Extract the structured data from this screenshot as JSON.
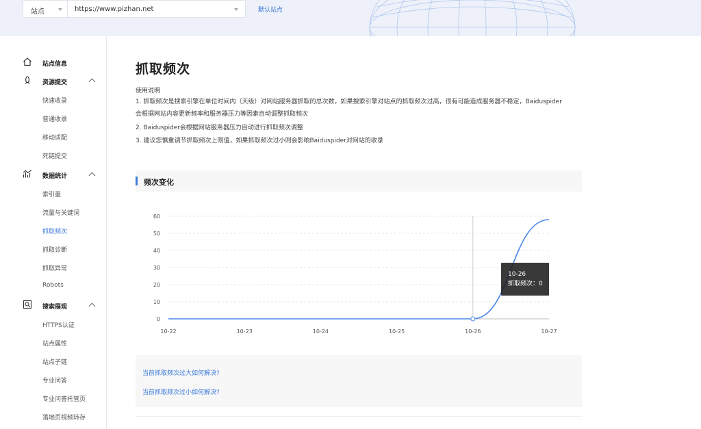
{
  "topbar": {
    "site_select_label": "站点",
    "url_value": "https://www.pizhan.net",
    "default_site_link": "默认站点"
  },
  "sidebar": {
    "groups": [
      {
        "label": "站点信息",
        "icon": "home-icon"
      },
      {
        "label": "资源提交",
        "icon": "submit-icon",
        "items": [
          "快速收录",
          "普通收录",
          "移动适配",
          "死链提交"
        ]
      },
      {
        "label": "数据统计",
        "icon": "stats-icon",
        "items": [
          "索引量",
          "流量与关键词",
          "抓取频次",
          "抓取诊断",
          "抓取异常",
          "Robots"
        ]
      },
      {
        "label": "搜索展现",
        "icon": "search-display-icon",
        "items": [
          "HTTPS认证",
          "站点属性",
          "站点子链",
          "专业问答",
          "专业问答托管页",
          "落地页视频转存"
        ]
      }
    ],
    "active_item": "抓取频次"
  },
  "main": {
    "title": "抓取频次",
    "usage_title": "使用说明",
    "usage_lines": [
      "1. 抓取频次是搜索引擎在单位时间内（天级）对网站服务器抓取的总次数，如果搜索引擎对站点的抓取频次过高，很有可能造成服务器不稳定，Baiduspider",
      "会根据网站内容更新频率和服务器压力等因素自动调整抓取频次",
      "2. Baiduspider会根据网站服务器压力自动进行抓取频次调整",
      "3. 建议您慎重调节抓取频次上限值，如果抓取频次过小则会影响Baiduspider对网站的收录"
    ],
    "section_title": "频次变化",
    "tooltip": {
      "date": "10-26",
      "text": "抓取频次：0"
    },
    "help_links": [
      "当前抓取频次过大如何解决?",
      "当前抓取频次过小如何解决?"
    ]
  },
  "chart_data": {
    "type": "line",
    "x": [
      "10-22",
      "10-23",
      "10-24",
      "10-25",
      "10-26",
      "10-27"
    ],
    "series": [
      {
        "values": [
          0,
          0,
          0,
          0,
          0,
          58
        ],
        "color": "#4a86e8"
      }
    ],
    "yticks": [
      0,
      10,
      20,
      30,
      40,
      50,
      60
    ],
    "ylim": [
      0,
      60
    ],
    "grid": true,
    "highlight_index": 4
  },
  "colors": {
    "accent": "#3b7ad8",
    "line": "#4a86e8"
  }
}
